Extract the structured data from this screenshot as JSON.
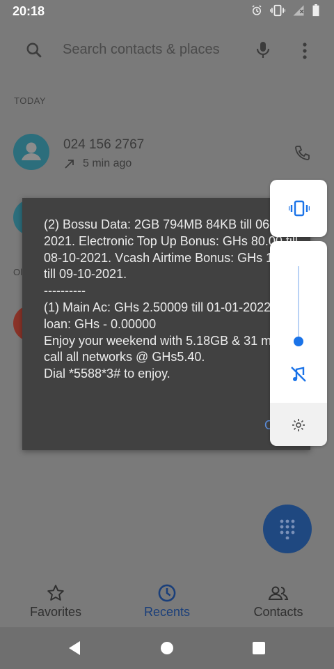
{
  "status_bar": {
    "time": "20:18",
    "icons": [
      "alarm-icon",
      "vibrate-icon",
      "no-signal-icon",
      "battery-icon"
    ]
  },
  "search": {
    "placeholder": "Search contacts & places",
    "icons": [
      "search-icon",
      "mic-icon",
      "more-vert-icon"
    ]
  },
  "recents": {
    "section_today": "TODAY",
    "items": [
      {
        "number": "024 156 2767",
        "time": "5 min ago",
        "avatar_color": "#2c6e7c"
      }
    ]
  },
  "dialog": {
    "message": "(2) Bossu Data: 2GB 794MB 84KB till 06-10-2021. Electronic Top Up Bonus: GHs 80.00 till 08-10-2021. Vcash Airtime Bonus: GHs 12.00 till 09-10-2021.\n----------\n(1) Main Ac: GHs 2.50009 till 01-01-2022. SOS loan: GHs - 0.00000\nEnjoy your weekend with 5.18GB & 31 mins to call all networks @ GHs5.40.\nDial *5588*3# to enjoy.",
    "button": "OK"
  },
  "volume_panel": {
    "ringer_icon": "vibrate-icon",
    "mute_icon": "music-off-icon",
    "settings_icon": "settings-icon",
    "level": 0.15,
    "accent_color": "#1a73e8"
  },
  "bottom_nav": {
    "tabs": [
      {
        "label": "Favorites",
        "icon": "star-icon",
        "active": false
      },
      {
        "label": "Recents",
        "icon": "clock-icon",
        "active": true
      },
      {
        "label": "Contacts",
        "icon": "people-icon",
        "active": false
      }
    ]
  },
  "colors": {
    "scrim": "#7a7a7a",
    "dialog_bg": "#414141",
    "fab": "#1f4880",
    "active_tab": "#1a3f7a"
  }
}
